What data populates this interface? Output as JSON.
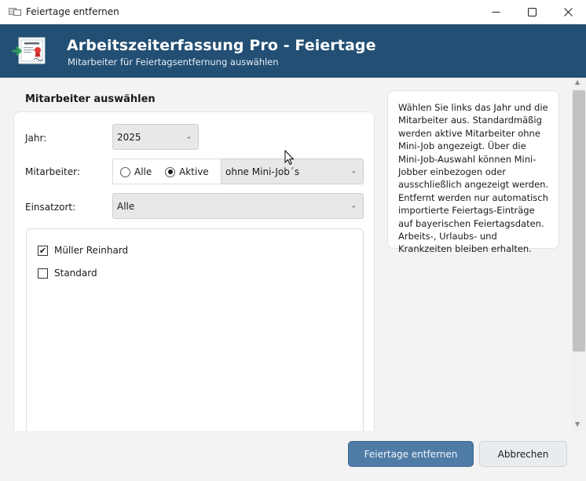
{
  "window": {
    "title": "Feiertage entfernen",
    "icon": "certificate-window-icon"
  },
  "header": {
    "title": "Arbeitszeiterfassung Pro - Feiertage",
    "subtitle": "Mitarbeiter für Feiertagsentfernung auswählen",
    "icon": "certificate-icon",
    "background": "#234f74"
  },
  "section": {
    "title": "Mitarbeiter auswählen"
  },
  "form": {
    "year_label": "Jahr:",
    "year_value": "2025",
    "employee_label": "Mitarbeiter:",
    "radio_all": "Alle",
    "radio_active": "Aktive",
    "radio_selected": "Aktive",
    "minijob_value": "ohne Mini-Job´s",
    "location_label": "Einsatzort:",
    "location_value": "Alle"
  },
  "employees": [
    {
      "name": "Müller Reinhard",
      "checked": true
    },
    {
      "name": "Standard",
      "checked": false
    }
  ],
  "info": {
    "text": "Wählen Sie links das Jahr und die Mitarbeiter aus. Standardmäßig werden aktive Mitarbeiter ohne Mini-Job angezeigt. Über die Mini-Job-Auswahl können Mini-Jobber einbezogen oder ausschließlich angezeigt werden. Entfernt werden nur automatisch importierte Feiertags-Einträge auf bayerischen Feiertagsdaten. Arbeits-, Urlaubs- und Krankzeiten bleiben erhalten."
  },
  "buttons": {
    "primary": "Feiertage entfernen",
    "secondary": "Abbrechen"
  },
  "colors": {
    "accent": "#234f74",
    "primary_button": "#4f7ca6"
  }
}
